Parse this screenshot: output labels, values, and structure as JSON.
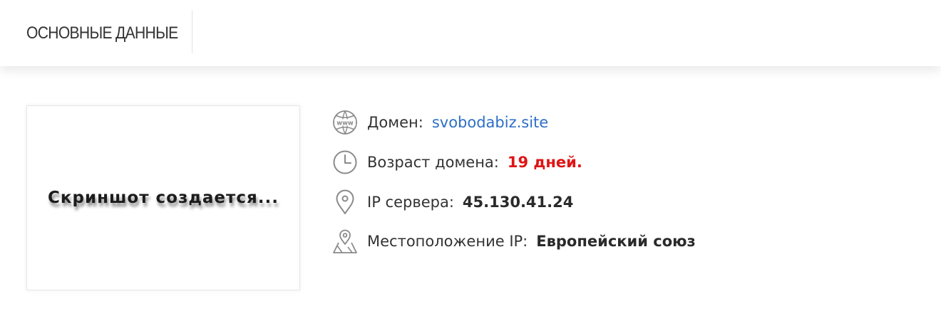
{
  "header": {
    "tab_label": "ОСНОВНЫЕ ДАННЫЕ"
  },
  "screenshot_placeholder": {
    "text": "Скриншот создается..."
  },
  "info": {
    "rows": [
      {
        "icon": "www-globe-icon",
        "label": "Домен:",
        "value": "svobodabiz.site",
        "value_color": "#2e6fc4"
      },
      {
        "icon": "clock-icon",
        "label": "Возраст домена:",
        "value": "19 дней.",
        "value_color": "#e01414"
      },
      {
        "icon": "location-pin-icon",
        "label": "IP сервера:",
        "value": "45.130.41.24",
        "value_color": "#2a2a2a"
      },
      {
        "icon": "map-pin-icon",
        "label": "Местоположение IP:",
        "value": "Европейский союз",
        "value_color": "#2a2a2a"
      }
    ]
  }
}
